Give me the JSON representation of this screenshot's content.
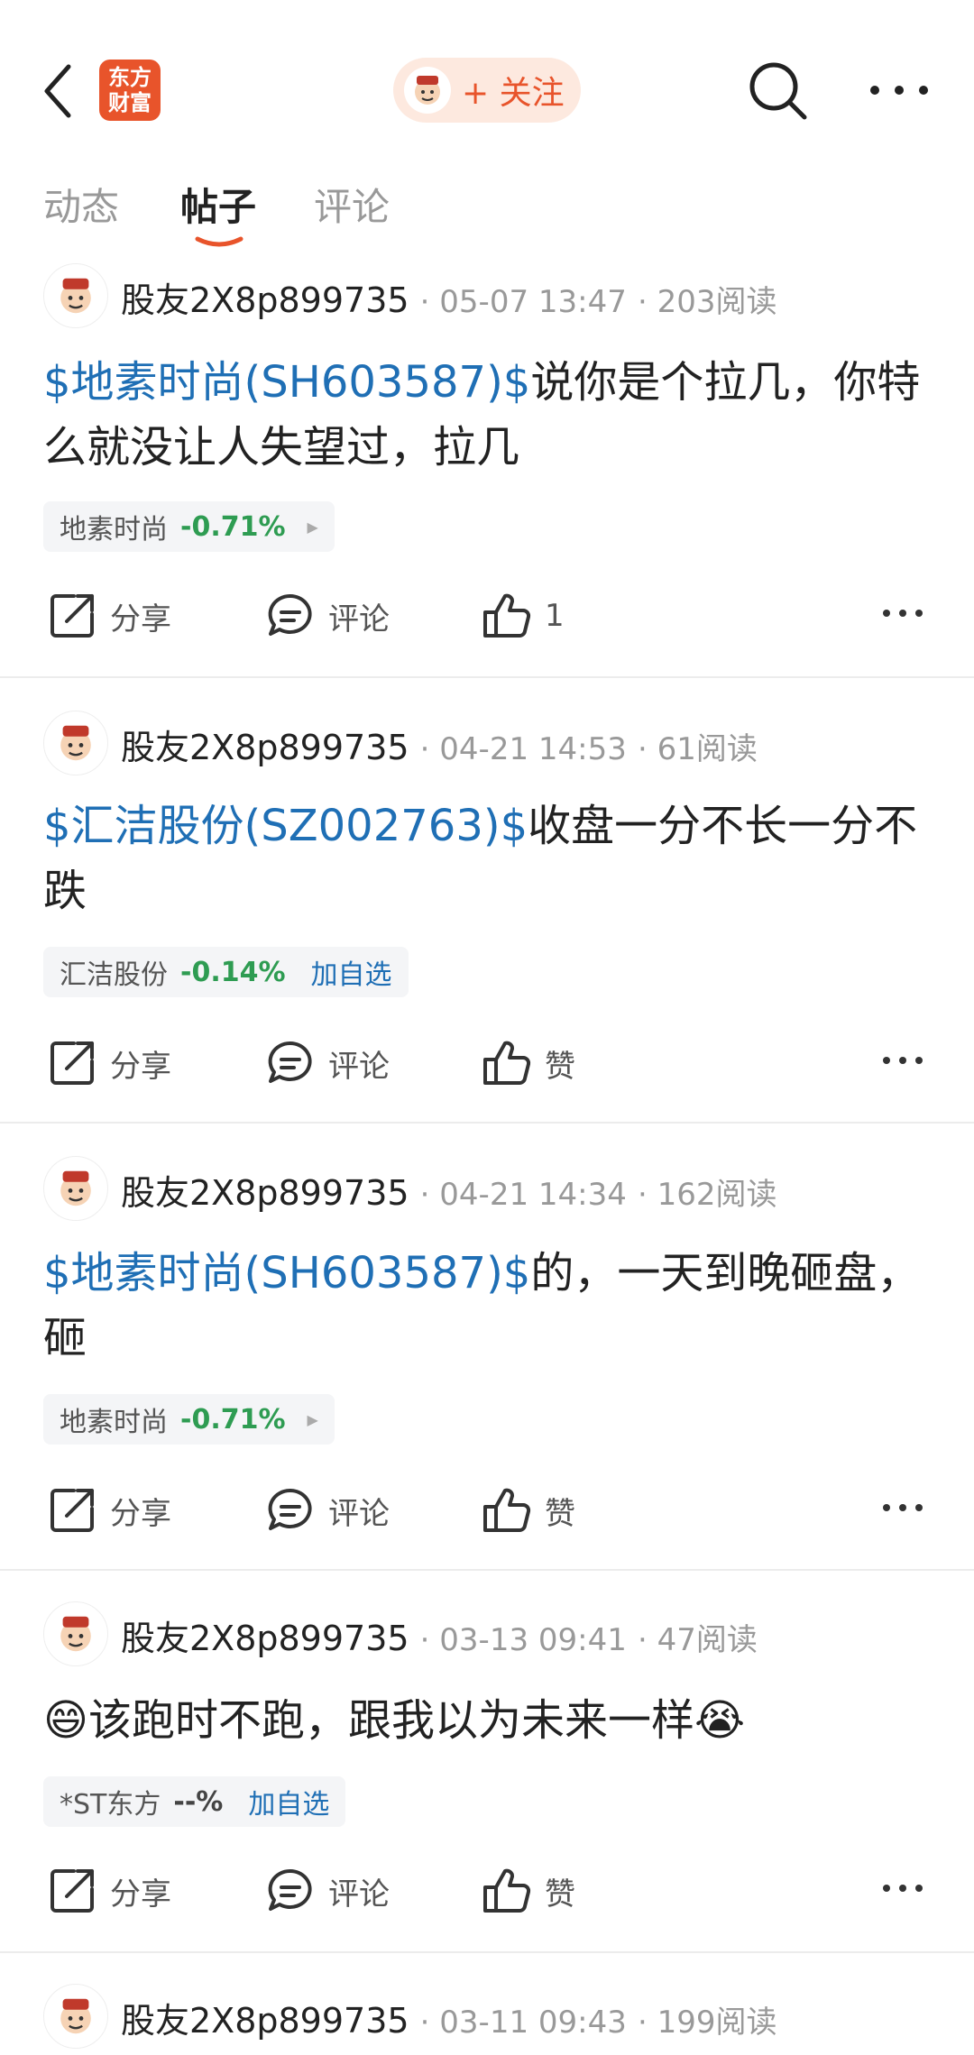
{
  "header": {
    "logo_line1": "东方",
    "logo_line2": "财富",
    "follow_label": "+ 关注"
  },
  "tabs": [
    {
      "label": "动态"
    },
    {
      "label": "帖子"
    },
    {
      "label": "评论"
    }
  ],
  "actions": {
    "share": "分享",
    "comment": "评论",
    "like": "赞"
  },
  "posts": [
    {
      "author": "股友2X8p899735",
      "time": "05-07 13:47",
      "reads": "203阅读",
      "stock_text": "$地素时尚(SH603587)$",
      "text": "说你是个拉几，你特么就没让人失望过，拉几",
      "tag_name": "地素时尚",
      "tag_pct": "-0.71%",
      "tag_extra": "",
      "likes": "1"
    },
    {
      "author": "股友2X8p899735",
      "time": "04-21 14:53",
      "reads": "61阅读",
      "stock_text": "$汇洁股份(SZ002763)$",
      "text": "收盘一分不长一分不跌",
      "tag_name": "汇洁股份",
      "tag_pct": "-0.14%",
      "tag_extra": "加自选",
      "likes": "赞"
    },
    {
      "author": "股友2X8p899735",
      "time": "04-21 14:34",
      "reads": "162阅读",
      "stock_text": "$地素时尚(SH603587)$",
      "text": "的，一天到晚砸盘，砸",
      "tag_name": "地素时尚",
      "tag_pct": "-0.71%",
      "tag_extra": "",
      "likes": "赞"
    },
    {
      "author": "股友2X8p899735",
      "time": "03-13 09:41",
      "reads": "47阅读",
      "stock_text": "",
      "text": "😄该跑时不跑，跟我以为未来一样😭",
      "tag_name": "*ST东方",
      "tag_pct": "--%",
      "tag_extra": "加自选",
      "likes": "赞"
    },
    {
      "author": "股友2X8p899735",
      "time": "03-11 09:43",
      "reads": "199阅读"
    }
  ],
  "colors": {
    "brand": "#e8542b",
    "stock_link": "#1f6fb5",
    "down_green": "#2e9c52"
  }
}
